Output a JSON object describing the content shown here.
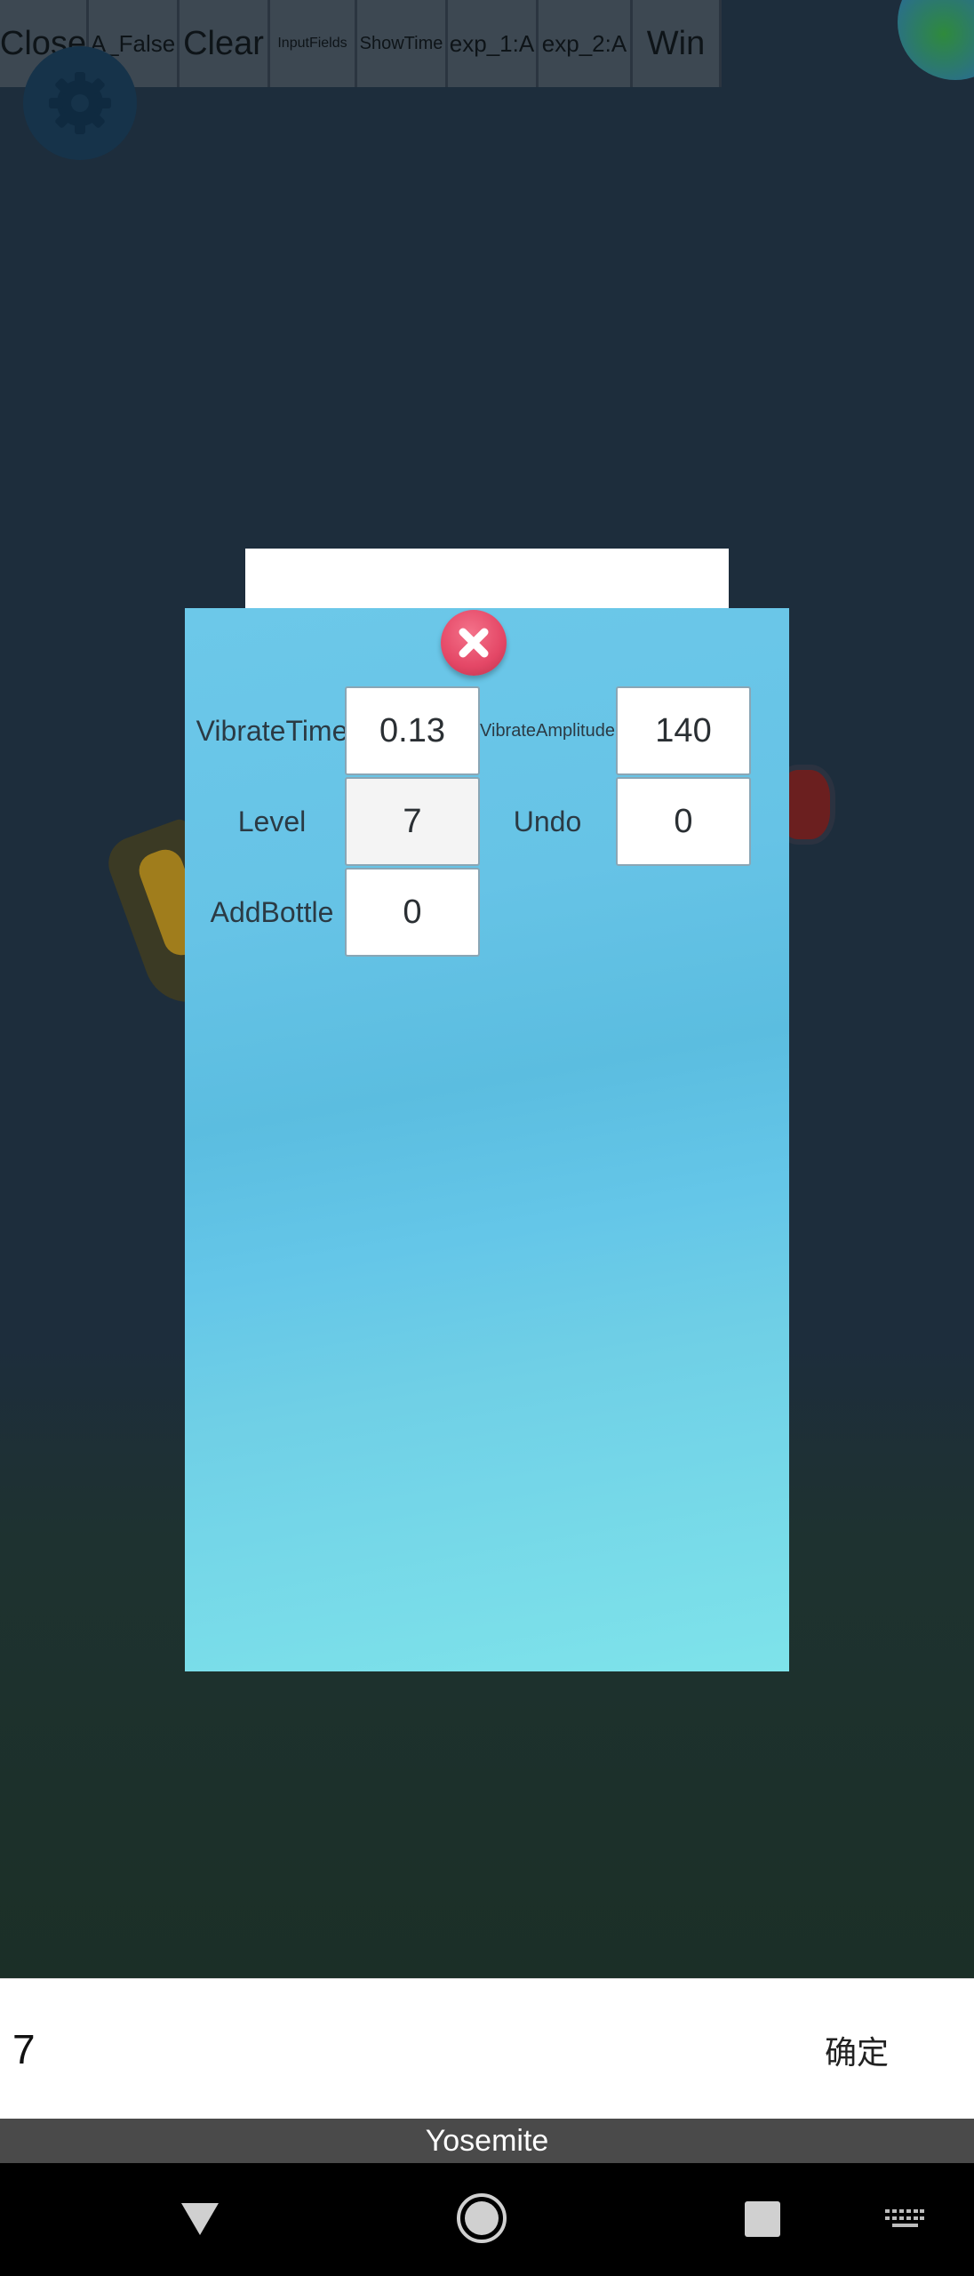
{
  "debug_bar": {
    "buttons": [
      {
        "label": "Close",
        "font_size": 38,
        "width": 100
      },
      {
        "label": "A_False",
        "font_size": 26,
        "width": 102
      },
      {
        "label": "Clear",
        "font_size": 38,
        "width": 102
      },
      {
        "label": "InputFields",
        "font_size": 16,
        "width": 98
      },
      {
        "label": "ShowTime",
        "font_size": 20,
        "width": 102
      },
      {
        "label": "exp_1:A",
        "font_size": 26,
        "width": 102
      },
      {
        "label": "exp_2:A",
        "font_size": 26,
        "width": 106
      },
      {
        "label": "Win",
        "font_size": 38,
        "width": 100
      }
    ]
  },
  "dialog": {
    "title": "",
    "fields": {
      "vibrate_time": {
        "label": "VibrateTime",
        "value": "0.13"
      },
      "vibrate_amplitude": {
        "label": "VibrateAmplitude",
        "value": "140"
      },
      "level": {
        "label": "Level",
        "value": "7"
      },
      "undo": {
        "label": "Undo",
        "value": "0"
      },
      "add_bottle": {
        "label": "AddBottle",
        "value": "0"
      }
    }
  },
  "ime": {
    "text": "7",
    "confirm_label": "确定",
    "keyboard_name": "Yosemite"
  },
  "icons": {
    "settings": "gear-icon",
    "close": "close-x-icon",
    "back": "nav-back-icon",
    "home": "nav-home-icon",
    "recent": "nav-recent-icon",
    "keyboard": "keyboard-icon"
  },
  "colors": {
    "panel_top": "#6cc8e9",
    "panel_bottom": "#7ee3ea",
    "close_button": "#e44766",
    "debug_button": "#3d4852"
  }
}
